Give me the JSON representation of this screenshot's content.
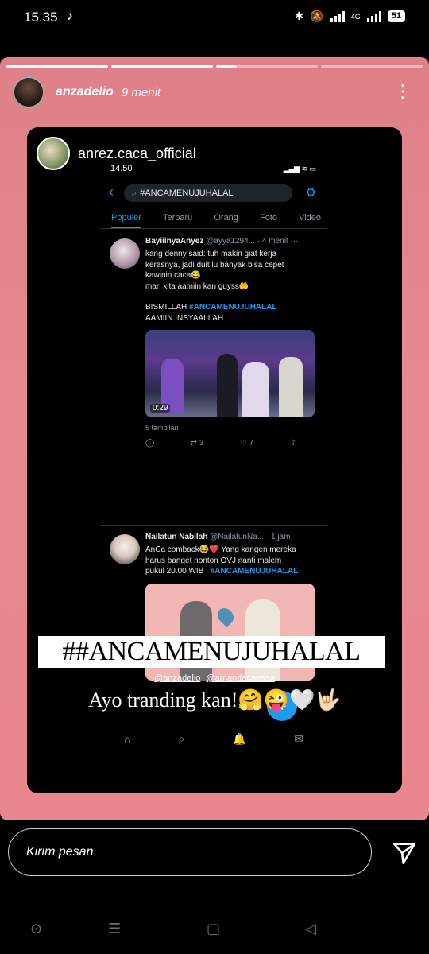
{
  "status_bar": {
    "time": "15.35",
    "tiktok_icon": "tiktok-icon",
    "bluetooth_icon": "bluetooth-icon",
    "mute_icon": "mute-icon",
    "network_label": "4G",
    "battery": "51"
  },
  "story": {
    "username": "anzadelio",
    "posted_ago": "9 menit",
    "more_icon": "more-vertical-icon",
    "progress_segments": 4,
    "active_segment": 2
  },
  "card": {
    "username": "anrez.caca_official",
    "twitter": {
      "time": "14.50",
      "search_query": "#ANCAMENUJUHALAL",
      "tabs": [
        "Populer",
        "Terbaru",
        "Orang",
        "Foto",
        "Video"
      ],
      "active_tab": "Populer",
      "tweets": [
        {
          "name": "BayiiinyaAnyez",
          "handle": "@ayya1294...",
          "time": "· 4 menit ···",
          "text_lines": [
            "kang denny said: tuh makin giat kerja",
            "kerasnya, jadi duit lu banyak bisa cepet",
            "kawinin caca😂",
            "mari kita aamiin kan guyss🤲"
          ],
          "text_pre_tag": "BISMILLAH ",
          "hashtag": "#ANCAMENUJUHALAL",
          "text_after": "AAMIIN INSYAALLAH",
          "video_duration": "0:29",
          "views": "5 tampilan",
          "retweets": "3",
          "likes": "7"
        },
        {
          "name": "Nailatun Nabilah",
          "handle": "@NailatunNa...",
          "time": "· 1 jam ···",
          "text_lines": [
            "AnCa comback😂❤️ Yang kangen mereka",
            "harus banget nonton OVJ nanti malem"
          ],
          "text_pre_tag": "pukul 20.00 WIB ! ",
          "hashtag": "#ANCAMENUJUHALAL"
        }
      ]
    },
    "hashtag_banner": "##ANCAMENUJUHALAL",
    "mentions": [
      "@anzadelio",
      "@amandacaesaa"
    ],
    "caption": "Ayo tranding kan!🤗😜🤍🤟🏻"
  },
  "message_bar": {
    "placeholder": "Kirim pesan",
    "send_icon": "send-icon"
  },
  "android_nav": [
    "assistant-icon",
    "menu-icon",
    "home-icon",
    "back-icon"
  ]
}
